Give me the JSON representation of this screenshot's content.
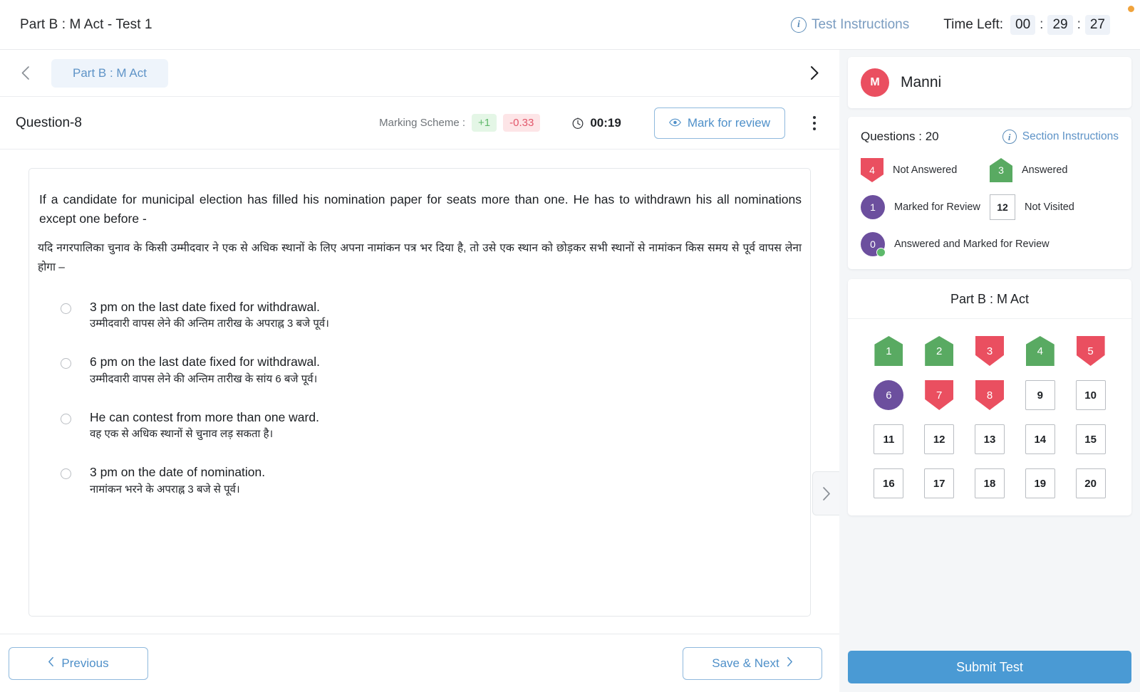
{
  "topbar": {
    "title": "Part B : M Act - Test 1",
    "test_instructions_label": "Test Instructions",
    "info_glyph": "i",
    "timer": {
      "label": "Time Left:",
      "hours": "00",
      "minutes": "29",
      "seconds": "27",
      "separator": ":"
    }
  },
  "section_bar": {
    "active_tab": "Part B : M Act"
  },
  "question_bar": {
    "question_number": "Question-8",
    "marking_scheme_label": "Marking Scheme :",
    "marks_positive": "+1",
    "marks_negative": "-0.33",
    "question_timer": "00:19",
    "mark_for_review_label": "Mark for review"
  },
  "question": {
    "text_en": "If a candidate for municipal election has filled his nomination paper for seats more than one. He has to withdrawn his all nominations except one before -",
    "text_hi": "यदि नगरपालिका चुनाव के किसी उम्मीदवार ने एक से अधिक स्थानों के लिए अपना नामांकन पत्र भर दिया है, तो उसे एक स्थान को छोड़कर सभी स्थानों से नामांकन किस समय से पूर्व वापस लेना होगा –",
    "options": [
      {
        "en": "3 pm on the last date fixed for withdrawal.",
        "hi": "उम्मीदवारी वापस लेने की अन्तिम तारीख के अपराह्न 3 बजे पूर्व।",
        "selected": false
      },
      {
        "en": "6 pm on the last date fixed for withdrawal.",
        "hi": "उम्मीदवारी वापस लेने की अन्तिम तारीख के सांय 6 बजे पूर्व।",
        "selected": false
      },
      {
        "en": "He can contest from more than one ward.",
        "hi": "वह एक से अधिक स्थानों से चुनाव लड़ सकता है।",
        "selected": false
      },
      {
        "en": "3 pm on the date of nomination.",
        "hi": "नामांकन भरने के अपराह्न 3 बजे से पूर्व।",
        "selected": false
      }
    ]
  },
  "bottom_nav": {
    "previous_label": "Previous",
    "save_next_label": "Save & Next"
  },
  "sidebar": {
    "user": {
      "initial": "M",
      "name": "Manni"
    },
    "questions_count_label": "Questions : 20",
    "section_instructions_label": "Section Instructions",
    "legend": [
      {
        "count": "4",
        "label": "Not Answered",
        "type": "na"
      },
      {
        "count": "3",
        "label": "Answered",
        "type": "ans"
      },
      {
        "count": "1",
        "label": "Marked for Review",
        "type": "mfr"
      },
      {
        "count": "12",
        "label": "Not Visited",
        "type": "nv"
      },
      {
        "count": "0",
        "label": "Answered and Marked for Review",
        "type": "ansmfr"
      }
    ],
    "palette_title": "Part B : M Act",
    "palette": [
      {
        "n": "1",
        "state": "answered"
      },
      {
        "n": "2",
        "state": "answered"
      },
      {
        "n": "3",
        "state": "notanswered"
      },
      {
        "n": "4",
        "state": "answered"
      },
      {
        "n": "5",
        "state": "notanswered"
      },
      {
        "n": "6",
        "state": "marked"
      },
      {
        "n": "7",
        "state": "notanswered"
      },
      {
        "n": "8",
        "state": "notanswered"
      },
      {
        "n": "9",
        "state": "notvisited"
      },
      {
        "n": "10",
        "state": "notvisited"
      },
      {
        "n": "11",
        "state": "notvisited"
      },
      {
        "n": "12",
        "state": "notvisited"
      },
      {
        "n": "13",
        "state": "notvisited"
      },
      {
        "n": "14",
        "state": "notvisited"
      },
      {
        "n": "15",
        "state": "notvisited"
      },
      {
        "n": "16",
        "state": "notvisited"
      },
      {
        "n": "17",
        "state": "notvisited"
      },
      {
        "n": "18",
        "state": "notvisited"
      },
      {
        "n": "19",
        "state": "notvisited"
      },
      {
        "n": "20",
        "state": "notvisited"
      }
    ],
    "submit_label": "Submit Test"
  },
  "colors": {
    "accent_blue": "#4a9ad4",
    "link_blue": "#5e93c7",
    "green": "#59aa62",
    "red": "#ea4f60",
    "purple": "#6c4f9e",
    "orange_dot": "#f0a33c"
  }
}
